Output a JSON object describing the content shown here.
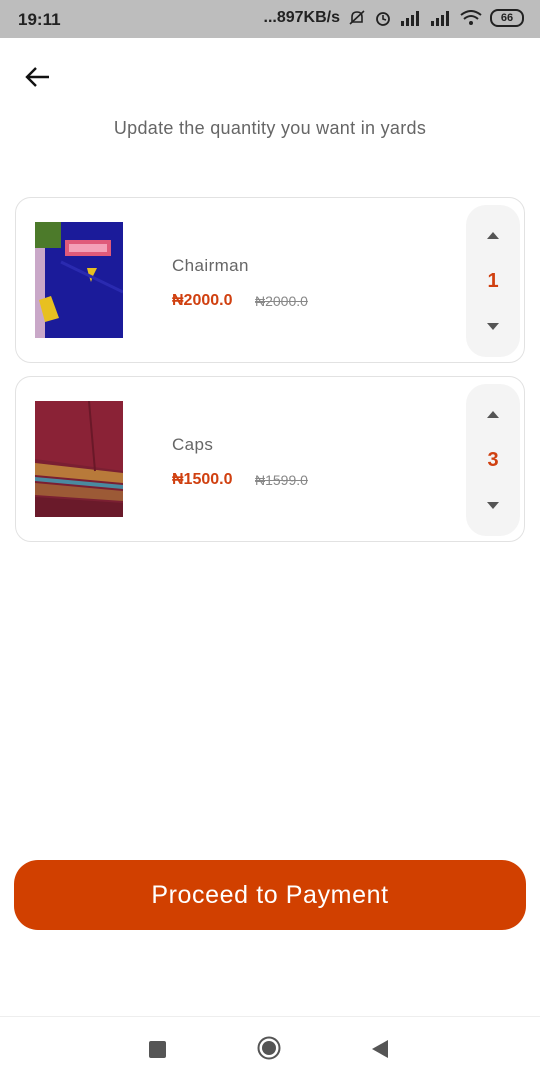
{
  "status_bar": {
    "time": "19:11",
    "network_speed": "...897KB/s",
    "battery": "66"
  },
  "header": {
    "subtitle": "Update the quantity you want in yards"
  },
  "cart": {
    "items": [
      {
        "name": "Chairman",
        "price": "₦2000.0",
        "old_price": "₦2000.0",
        "quantity": "1"
      },
      {
        "name": "Caps",
        "price": "₦1500.0",
        "old_price": "₦1599.0",
        "quantity": "3"
      }
    ]
  },
  "actions": {
    "proceed_label": "Proceed to Payment"
  },
  "colors": {
    "accent": "#d14000",
    "price": "#d04010",
    "subtitle": "#666666"
  }
}
